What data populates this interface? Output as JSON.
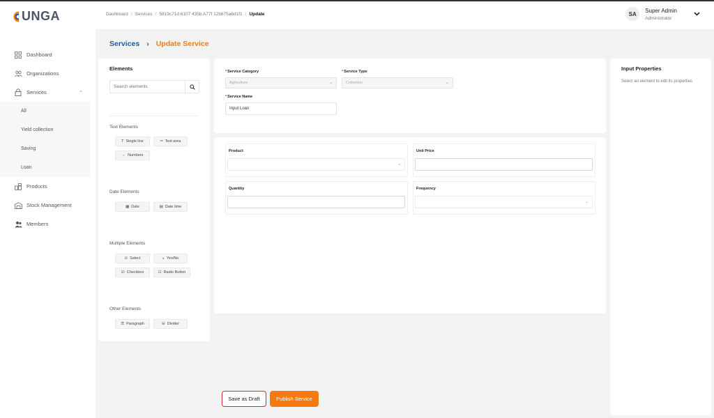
{
  "brand": {
    "logo_text": "UNGA",
    "accent": "#ee7b12",
    "primary": "#1a5aa8"
  },
  "header": {
    "breadcrumb": [
      "Dashboard",
      "Services",
      "5819c71d 6107 435b A77f 12b875a6d1f1"
    ],
    "breadcrumb_current": "Update",
    "user": {
      "initials": "SA",
      "name": "Super Admin",
      "role": "Administrator"
    }
  },
  "sidebar": {
    "items": [
      {
        "label": "Dashboard",
        "icon": "grid-icon"
      },
      {
        "label": "Organizations",
        "icon": "users-icon"
      },
      {
        "label": "Services",
        "icon": "lock-icon",
        "expanded": true
      },
      {
        "label": "Products",
        "icon": "box-icon"
      },
      {
        "label": "Stock Management",
        "icon": "warehouse-icon"
      },
      {
        "label": "Members",
        "icon": "members-icon"
      }
    ],
    "services_sub": [
      "All",
      "Yield collection",
      "Saving",
      "Loan"
    ]
  },
  "page": {
    "parent": "Services",
    "title": "Update Service"
  },
  "elements_panel": {
    "title": "Elements",
    "search_placeholder": "Search elements",
    "groups": {
      "text": {
        "label": "Text Elements",
        "items": [
          "Single line",
          "Text area",
          "Numbers"
        ]
      },
      "date": {
        "label": "Date Elements",
        "items": [
          "Date",
          "Date time"
        ]
      },
      "multiple": {
        "label": "Multiple Elements",
        "items": [
          "Select",
          "Yes/No",
          "Checkbox",
          "Radio Button"
        ]
      },
      "other": {
        "label": "Other Elements",
        "items": [
          "Paragraph",
          "Divider"
        ]
      }
    }
  },
  "form": {
    "category": {
      "label": "Service Category",
      "value": "Agriculture"
    },
    "type": {
      "label": "Service Type",
      "value": "Collection"
    },
    "name": {
      "label": "Service Name",
      "value": "Input Loan"
    }
  },
  "canvas_fields": [
    {
      "label": "Product",
      "kind": "select"
    },
    {
      "label": "Unit Price",
      "kind": "input"
    },
    {
      "label": "Quantity",
      "kind": "input"
    },
    {
      "label": "Frequency",
      "kind": "select"
    }
  ],
  "properties": {
    "title": "Input Properties",
    "hint": "Select an element to edit its properties"
  },
  "actions": {
    "draft": "Save as Draft",
    "publish": "Publish Service"
  }
}
